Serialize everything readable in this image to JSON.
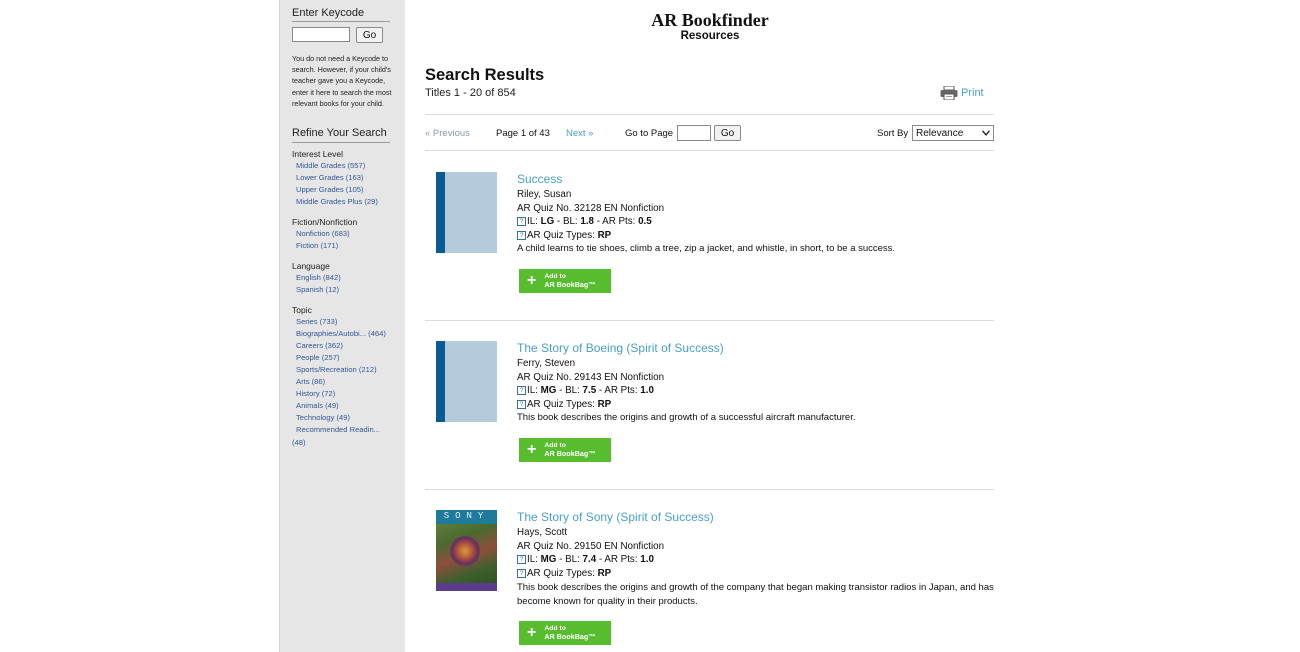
{
  "header": {
    "title": "AR Bookfinder",
    "subtitle": "Resources"
  },
  "sidebar": {
    "keycode": {
      "title": "Enter Keycode",
      "input_value": "",
      "go_label": "Go",
      "help_text": "You do not need a Keycode to search. However, if your child's teacher gave you a Keycode, enter it here to search the most relevant books for your child."
    },
    "refine_title": "Refine Your Search",
    "facets": [
      {
        "title": "Interest Level",
        "items": [
          "Middle Grades (557)",
          "Lower Grades (163)",
          "Upper Grades (105)",
          "Middle Grades Plus (29)"
        ]
      },
      {
        "title": "Fiction/Nonfiction",
        "items": [
          "Nonfiction (683)",
          "Fiction (171)"
        ]
      },
      {
        "title": "Language",
        "items": [
          "English (842)",
          "Spanish (12)"
        ]
      },
      {
        "title": "Topic",
        "items": [
          "Series (733)",
          "Biographies/Autobi... (464)",
          "Careers (362)",
          "People (257)",
          "Sports/Recreation (212)",
          "Arts (86)",
          "History (72)",
          "Animals (49)",
          "Technology (49)",
          "Recommended Readin..."
        ]
      }
    ],
    "topic_overflow": "(48)"
  },
  "results": {
    "title": "Search Results",
    "count": "Titles 1 - 20 of 854",
    "print_label": "Print",
    "pagination": {
      "prev_label": "« Previous",
      "page_info": "Page 1 of 43",
      "next_label": "Next »",
      "goto_label": "Go to Page",
      "goto_value": "",
      "go_label": "Go",
      "sort_label": "Sort By",
      "sort_value": "Relevance"
    },
    "items": [
      {
        "title": "Success",
        "author": "Riley, Susan",
        "quiz": "AR Quiz No. 32128 EN Nonfiction",
        "il_prefix": "IL: ",
        "il": "LG",
        "bl_prefix": " - BL: ",
        "bl": "1.8",
        "pts_prefix": " - AR Pts: ",
        "pts": "0.5",
        "quiz_types_prefix": "AR Quiz Types: ",
        "quiz_types": "RP",
        "summary": "A child learns to tie shoes, climb a tree, zip a jacket, and whistle, in short, to be a success.",
        "bookbag_line1": "Add to",
        "bookbag_line2": "AR BookBag™"
      },
      {
        "title": "The Story of Boeing (Spirit of Success)",
        "author": "Ferry, Steven",
        "quiz": "AR Quiz No. 29143 EN Nonfiction",
        "il_prefix": "IL: ",
        "il": "MG",
        "bl_prefix": " - BL: ",
        "bl": "7.5",
        "pts_prefix": " - AR Pts: ",
        "pts": "1.0",
        "quiz_types_prefix": "AR Quiz Types: ",
        "quiz_types": "RP",
        "summary": "This book describes the origins and growth of a successful aircraft manufacturer.",
        "bookbag_line1": "Add to",
        "bookbag_line2": "AR BookBag™"
      },
      {
        "title": "The Story of Sony (Spirit of Success)",
        "author": "Hays, Scott",
        "quiz": "AR Quiz No. 29150 EN Nonfiction",
        "il_prefix": "IL: ",
        "il": "MG",
        "bl_prefix": " - BL: ",
        "bl": "7.4",
        "pts_prefix": " - AR Pts: ",
        "pts": "1.0",
        "quiz_types_prefix": "AR Quiz Types: ",
        "quiz_types": "RP",
        "summary": "This book describes the origins and growth of the company that began making transistor radios in Japan, and has become known for quality in their products.",
        "cover_text": "SONY",
        "bookbag_line1": "Add to",
        "bookbag_line2": "AR BookBag™"
      }
    ]
  },
  "colors": {
    "link": "#4aa0c8",
    "facet_link": "#33579a",
    "sidebar_bg": "#e6e6e6",
    "bookbag_green": "#57bd2e",
    "spine_blue": "#0a5b94"
  },
  "icons": {
    "print": "printer-icon",
    "info": "question-box-icon",
    "add": "plus-icon",
    "dropdown": "chevron-down-icon"
  }
}
